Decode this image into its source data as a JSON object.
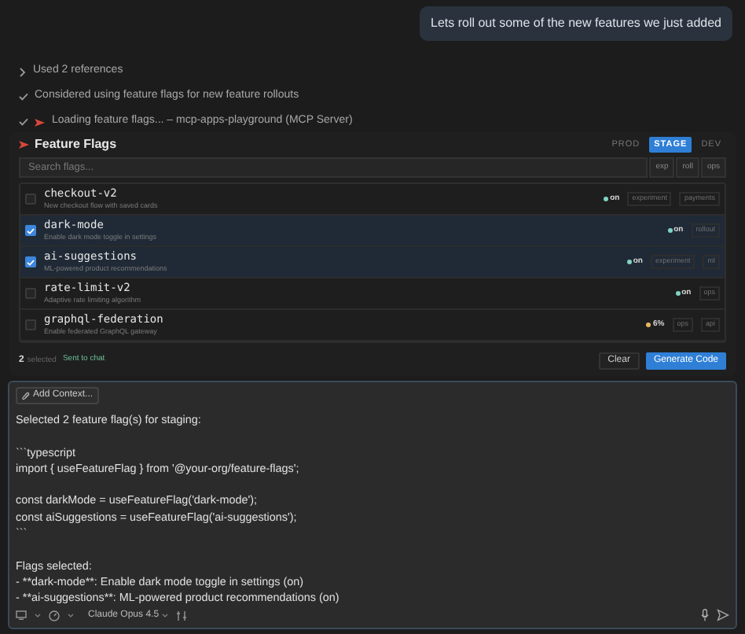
{
  "user_message": "Lets roll out some of the new features we just added",
  "steps": [
    {
      "kind": "chevron",
      "text": "Used 2 references"
    },
    {
      "kind": "check",
      "text": "Considered using feature flags for new feature rollouts"
    },
    {
      "kind": "tool",
      "text": "Loading feature flags... – mcp-apps-playground (MCP Server)"
    }
  ],
  "panel": {
    "title": "Feature Flags",
    "environments": [
      {
        "label": "PROD",
        "selected": false
      },
      {
        "label": "STAGE",
        "selected": true
      },
      {
        "label": "DEV",
        "selected": false
      }
    ],
    "search": {
      "placeholder": "Search flags..."
    },
    "filters": [
      "exp",
      "roll",
      "ops"
    ],
    "flags": [
      {
        "name": "checkout-v2",
        "description": "New checkout flow with saved cards",
        "checked": false,
        "status": "on",
        "color": "#7fd3c4",
        "tags": [
          "experiment",
          "payments"
        ]
      },
      {
        "name": "dark-mode",
        "description": "Enable dark mode toggle in settings",
        "checked": true,
        "status": "on",
        "color": "#7fd3c4",
        "tags": [
          "rollout"
        ]
      },
      {
        "name": "ai-suggestions",
        "description": "ML-powered product recommendations",
        "checked": true,
        "status": "on",
        "color": "#7fd3c4",
        "tags": [
          "experiment",
          "ml"
        ]
      },
      {
        "name": "rate-limit-v2",
        "description": "Adaptive rate limiting algorithm",
        "checked": false,
        "status": "on",
        "color": "#7fd3c4",
        "tags": [
          "ops"
        ]
      },
      {
        "name": "graphql-federation",
        "description": "Enable federated GraphQL gateway",
        "checked": false,
        "status": "6%",
        "color": "#e8b860",
        "tags": [
          "ops",
          "api"
        ]
      }
    ],
    "selected_count": "2",
    "selected_label": "selected",
    "sent_label": "Sent to chat",
    "buttons": [
      {
        "kind": "secondary",
        "label": "Clear"
      },
      {
        "kind": "primary",
        "label": "Generate Code"
      }
    ]
  },
  "composer": {
    "context_button": "Add Context...",
    "text": "Selected 2 feature flag(s) for staging:\n\n```typescript\nimport { useFeatureFlag } from '@your-org/feature-flags';\n\nconst darkMode = useFeatureFlag('dark-mode');\nconst aiSuggestions = useFeatureFlag('ai-suggestions');\n```\n\nFlags selected:\n- **dark-mode**: Enable dark mode toggle in settings (on)\n- **ai-suggestions**: ML-powered product recommendations (on)",
    "model": "Claude Opus 4.5"
  }
}
